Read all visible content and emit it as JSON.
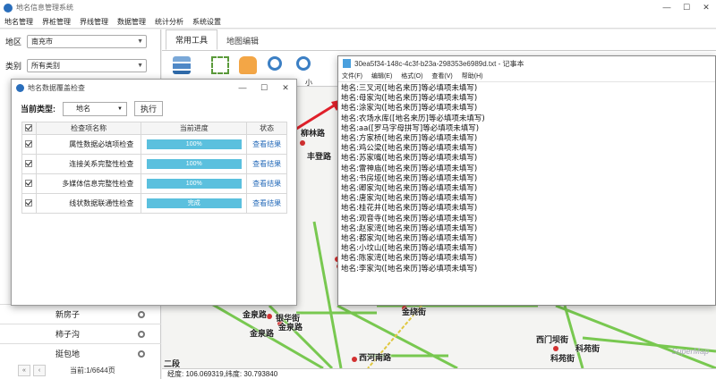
{
  "app": {
    "title": "地名信息管理系统"
  },
  "menu": [
    "地名管理",
    "界桩管理",
    "界线管理",
    "数据管理",
    "统计分析",
    "系统设置"
  ],
  "left": {
    "region_label": "地区",
    "region_value": "南充市",
    "category_label": "类别",
    "category_value": "所有类别",
    "rows": [
      "新房子",
      "柿子沟",
      "挺包地"
    ],
    "pager": {
      "first": "«",
      "prev": "‹",
      "info": "当前:1/6644页"
    }
  },
  "tabs": [
    "常用工具",
    "地图编辑"
  ],
  "toolbar": {
    "partial_label": "小"
  },
  "map": {
    "labels": [
      "柳林路",
      "丰登路",
      "金泉路",
      "银华街",
      "金泉路",
      "金绕街",
      "金泉路",
      "西河南路",
      "西门坝街",
      "科苑街",
      "科苑街",
      "二段"
    ],
    "status": "经度: 106.069319,纬度: 30.793840",
    "watermark": "SuperMap"
  },
  "dialog": {
    "title": "地名数据覆盖检查",
    "type_label": "当前类型:",
    "type_value": "地名",
    "run_label": "执行",
    "headers": {
      "name": "检查项名称",
      "progress": "当前进度",
      "status": "状态"
    },
    "rows": [
      {
        "name": "属性数据必填项检查",
        "progress_text": "100%",
        "progress": 1.0,
        "status": "查看结果"
      },
      {
        "name": "连接关系完整性检查",
        "progress_text": "100%",
        "progress": 1.0,
        "status": "查看结果"
      },
      {
        "name": "多媒体信息完整性检查",
        "progress_text": "100%",
        "progress": 1.0,
        "status": "查看结果"
      },
      {
        "name": "线状数据联通性检查",
        "progress_text": "完成",
        "progress": 1.0,
        "status": "查看结果"
      }
    ]
  },
  "notepad": {
    "title": "30ea5f34-148c-4c3f-b23a-298353e6989d.txt - 记事本",
    "menu": [
      "文件(F)",
      "编辑(E)",
      "格式(O)",
      "查看(V)",
      "帮助(H)"
    ],
    "lines": [
      "地名:三叉河([地名来历]等必填项未填写)",
      "地名:母家沟([地名来历]等必填项未填写)",
      "地名:涂家沟([地名来历]等必填项未填写)",
      "地名:农场水库([地名来历]等必填项未填写)",
      "地名:aa([罗马字母拼写]等必填项未填写)",
      "地名:方家桥([地名来历]等必填项未填写)",
      "地名:鸡公梁([地名来历]等必填项未填写)",
      "地名:苏家嘴([地名来历]等必填项未填写)",
      "地名:雷神庙([地名来历]等必填项未填写)",
      "地名:书房垭([地名来历]等必填项未填写)",
      "地名:卿家沟([地名来历]等必填项未填写)",
      "地名:唐家沟([地名来历]等必填项未填写)",
      "地名:桂花井([地名来历]等必填项未填写)",
      "地名:观音寺([地名来历]等必填项未填写)",
      "地名:赵家湾([地名来历]等必填项未填写)",
      "地名:都家沟([地名来历]等必填项未填写)",
      "地名:小坟山([地名来历]等必填项未填写)",
      "地名:陈家湾([地名来历]等必填项未填写)",
      "地名:李家沟([地名来历]等必填项未填写)"
    ]
  },
  "colors": {
    "accent": "#2a6ebb",
    "progress": "#5bc0de",
    "road": "#78c850",
    "arrow": "#e0202a"
  }
}
